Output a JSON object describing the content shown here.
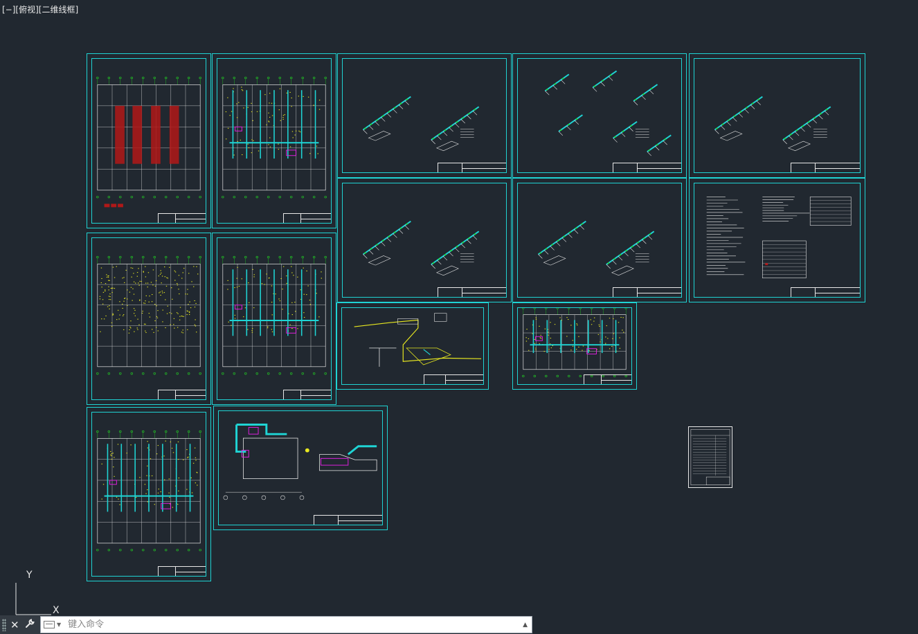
{
  "viewport": {
    "label": "[−][俯视][二维线框]"
  },
  "ucs": {
    "y_label": "Y",
    "x_label": "X"
  },
  "command_line": {
    "placeholder": "键入命令",
    "close_icon": "✕",
    "settings_icon": "wrench-icon",
    "history_icon": "▲"
  },
  "colors": {
    "background": "#212830",
    "sheet_border": "#1fd4d4",
    "plan_line": "#e8e8e8",
    "grid_marker": "#22dd22",
    "duct": "#1fd4d4",
    "fill_red": "#b01818",
    "annotation_yellow": "#e8e820",
    "highlight_magenta": "#e020e0"
  },
  "sheets": [
    {
      "name": "floor-plan-red"
    },
    {
      "name": "floor-plan-ducts-1"
    },
    {
      "name": "system-diagram-1"
    },
    {
      "name": "system-diagram-2"
    },
    {
      "name": "system-diagram-3"
    },
    {
      "name": "floor-plan-yellow"
    },
    {
      "name": "floor-plan-ducts-2"
    },
    {
      "name": "system-diagram-4"
    },
    {
      "name": "system-diagram-5"
    },
    {
      "name": "design-notes"
    },
    {
      "name": "piping-diagram"
    },
    {
      "name": "small-floor-plan"
    },
    {
      "name": "floor-plan-ducts-3"
    },
    {
      "name": "section-detail"
    },
    {
      "name": "drawing-list"
    }
  ]
}
